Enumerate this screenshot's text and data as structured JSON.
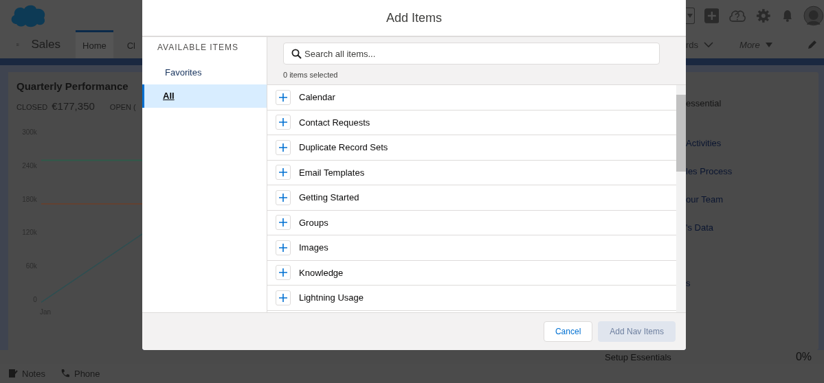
{
  "background": {
    "app_name": "Sales",
    "nav_tabs": [
      {
        "label": "Home",
        "selected": true
      },
      {
        "label": "Cl",
        "selected": false
      }
    ],
    "nav_right": [
      {
        "label": "rds",
        "kind": "dropdown"
      },
      {
        "label": "More",
        "kind": "more"
      }
    ],
    "left_card": {
      "title": "Quarterly Performance",
      "closed_label": "CLOSED",
      "closed_value": "€177,350",
      "open_label": "OPEN (",
      "y_axis_labels": [
        "300k",
        "240k",
        "180k",
        "120k",
        "60k",
        "0"
      ],
      "x_axis_labels": [
        "Jan"
      ]
    },
    "right_card": {
      "items": [
        {
          "text": "essential",
          "kind": "heading"
        },
        {
          "text": "Activities",
          "kind": "link"
        },
        {
          "text": "les Process",
          "kind": "link"
        },
        {
          "text": "our Team",
          "kind": "link"
        },
        {
          "text": "'s Data",
          "kind": "link"
        },
        {
          "text": "s",
          "kind": "text"
        }
      ]
    },
    "bottom_card": {
      "title": "Setup Essentials",
      "progress": "0%"
    },
    "utility_bar": [
      {
        "label": "Notes",
        "kind": "notes"
      },
      {
        "label": "Phone",
        "kind": "phone"
      }
    ]
  },
  "modal": {
    "title": "Add Items",
    "sidebar_heading": "AVAILABLE ITEMS",
    "sidebar_items": [
      {
        "label": "Favorites",
        "selected": false
      },
      {
        "label": "All",
        "selected": true
      }
    ],
    "search": {
      "placeholder": "Search all items..."
    },
    "selection_count": "0 items selected",
    "items": [
      "Calendar",
      "Contact Requests",
      "Duplicate Record Sets",
      "Email Templates",
      "Getting Started",
      "Groups",
      "Images",
      "Knowledge",
      "Lightning Usage"
    ],
    "buttons": [
      {
        "label": "Cancel",
        "disabled": false
      },
      {
        "label": "Add Nav Items",
        "disabled": true
      }
    ]
  }
}
